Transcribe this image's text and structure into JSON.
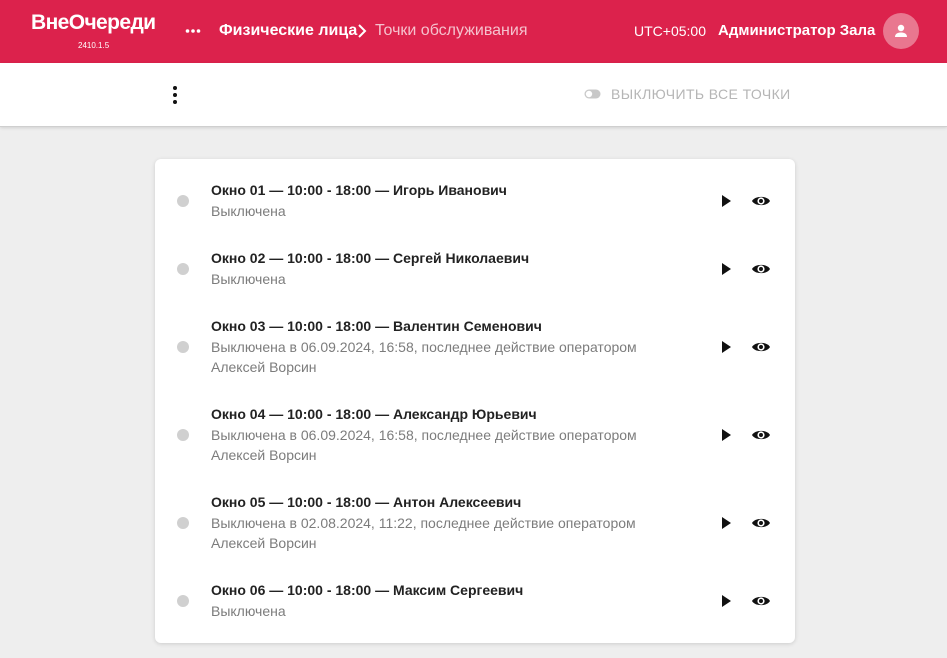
{
  "app": {
    "logo": "ВнеОчереди",
    "version": "2410.1.5"
  },
  "header": {
    "breadcrumb_parent": "Физические лица",
    "breadcrumb_current": "Точки обслуживания",
    "timezone": "UTC+05:00",
    "user_name": "Администратор Зала",
    "accent_color": "#dc224c"
  },
  "toolbar": {
    "disable_all_label": "ВЫКЛЮЧИТЬ ВСЕ ТОЧКИ"
  },
  "points": [
    {
      "title": "Окно 01 — 10:00 - 18:00 — Игорь Иванович",
      "status_line1": "Выключена",
      "status_line2": ""
    },
    {
      "title": "Окно 02 — 10:00 - 18:00 — Сергей Николаевич",
      "status_line1": "Выключена",
      "status_line2": ""
    },
    {
      "title": "Окно 03 — 10:00 - 18:00 — Валентин Семенович",
      "status_line1": "Выключена в 06.09.2024, 16:58, последнее действие оператором",
      "status_line2": "Алексей Ворсин"
    },
    {
      "title": "Окно 04 — 10:00 - 18:00 — Александр Юрьевич",
      "status_line1": "Выключена в 06.09.2024, 16:58, последнее действие оператором",
      "status_line2": "Алексей Ворсин"
    },
    {
      "title": "Окно 05 — 10:00 - 18:00 — Антон Алексеевич",
      "status_line1": "Выключена в 02.08.2024, 11:22, последнее действие оператором",
      "status_line2": "Алексей Ворсин"
    },
    {
      "title": "Окно 06 — 10:00 - 18:00 — Максим Сергеевич",
      "status_line1": "Выключена",
      "status_line2": ""
    }
  ]
}
